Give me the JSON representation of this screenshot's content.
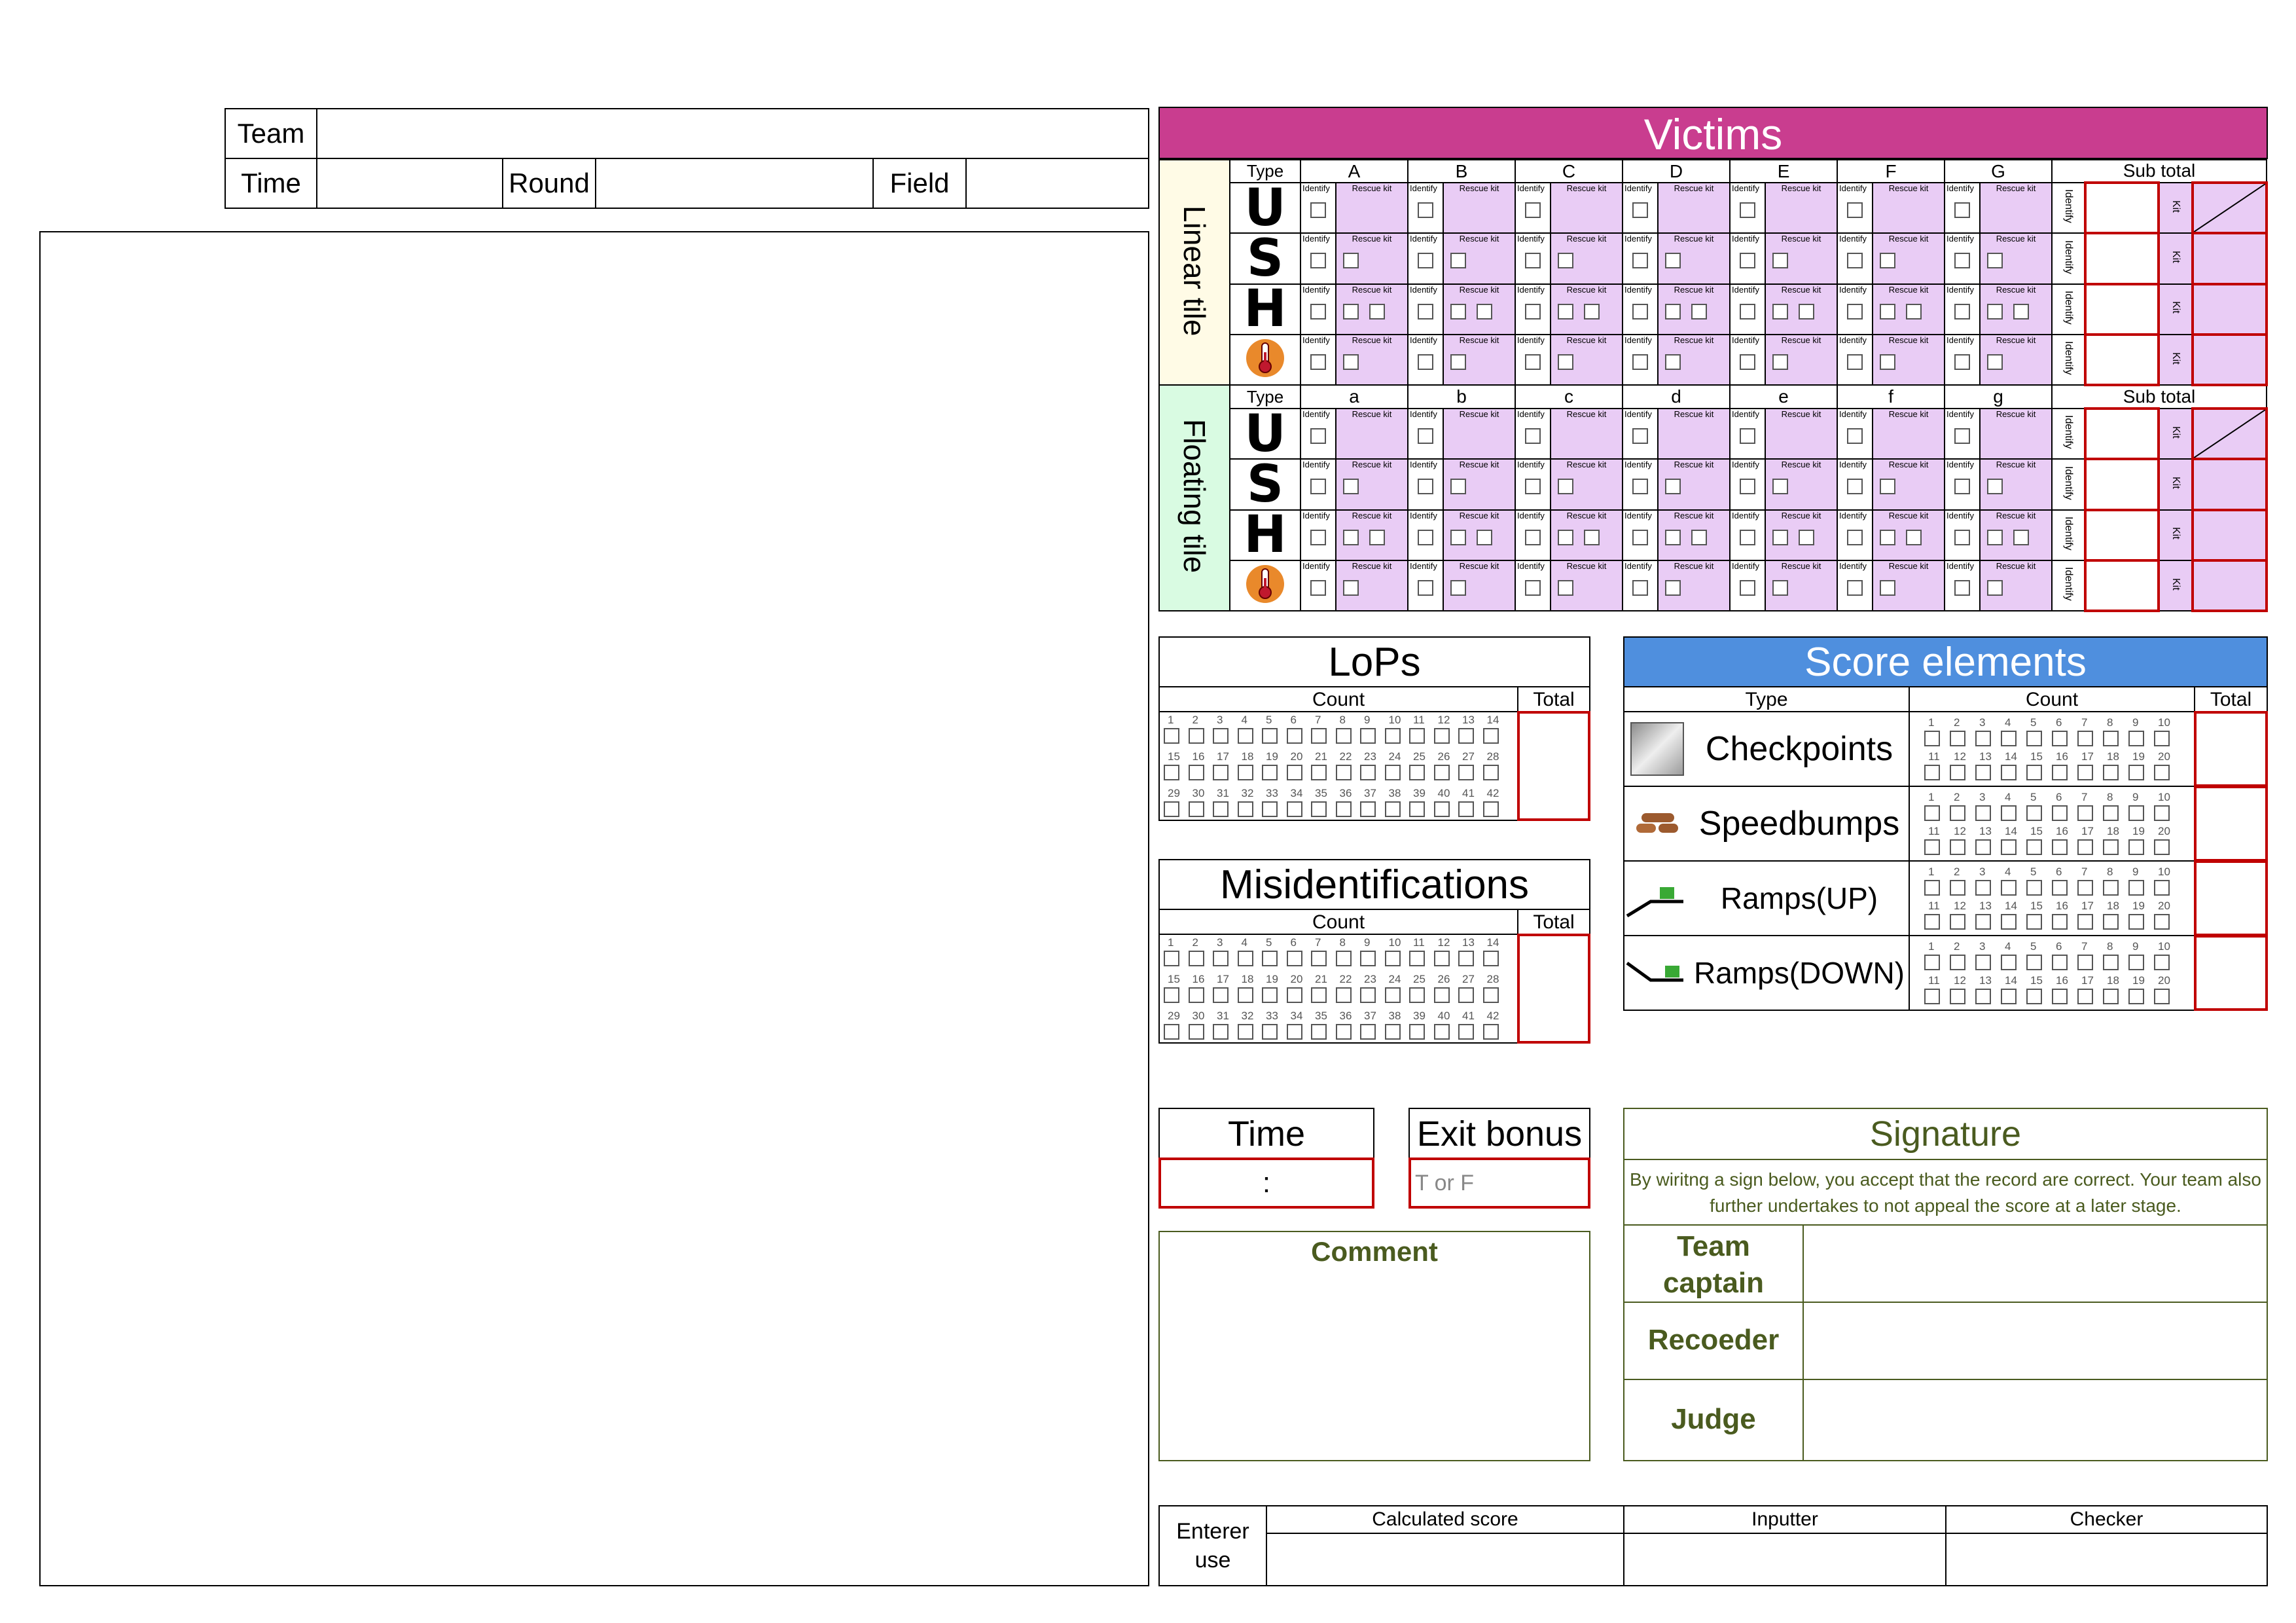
{
  "header": {
    "team_label": "Team",
    "time_label": "Time",
    "round_label": "Round",
    "field_label": "Field"
  },
  "victims": {
    "title": "Victims",
    "type_label": "Type",
    "subtotal_label": "Sub total",
    "linear_label": "Linear tile",
    "floating_label": "Floating tile",
    "linear_columns": [
      "A",
      "B",
      "C",
      "D",
      "E",
      "F",
      "G"
    ],
    "floating_columns": [
      "a",
      "b",
      "c",
      "d",
      "e",
      "f",
      "g"
    ],
    "row_types": [
      "U",
      "S",
      "H",
      "heat"
    ],
    "identify_label": "Identify",
    "rescue_kit_label": "Rescue kit",
    "kit_label": "Kit",
    "rescue_kit_boxes": [
      0,
      1,
      2,
      1
    ],
    "colors": {
      "header": "#c93d8f",
      "linear": "#fffbe6",
      "floating": "#d9fbe2",
      "pink": "#e9ccf5"
    }
  },
  "lops": {
    "title": "LoPs",
    "count_label": "Count",
    "total_label": "Total",
    "numbers": [
      "1",
      "2",
      "3",
      "4",
      "5",
      "6",
      "7",
      "8",
      "9",
      "10",
      "11",
      "12",
      "13",
      "14",
      "15",
      "16",
      "17",
      "18",
      "19",
      "20",
      "21",
      "22",
      "23",
      "24",
      "25",
      "26",
      "27",
      "28",
      "29",
      "30",
      "31",
      "32",
      "33",
      "34",
      "35",
      "36",
      "37",
      "38",
      "39",
      "40",
      "41",
      "42"
    ]
  },
  "misid": {
    "title": "Misidentifications",
    "count_label": "Count",
    "total_label": "Total"
  },
  "score_elements": {
    "title": "Score elements",
    "type_label": "Type",
    "count_label": "Count",
    "total_label": "Total",
    "color": "#4f8fde",
    "numbers": [
      "1",
      "2",
      "3",
      "4",
      "5",
      "6",
      "7",
      "8",
      "9",
      "10",
      "11",
      "12",
      "13",
      "14",
      "15",
      "16",
      "17",
      "18",
      "19",
      "20"
    ],
    "rows": [
      {
        "label": "Checkpoints",
        "icon": "checkpoint-icon"
      },
      {
        "label": "Speedbumps",
        "icon": "speedbump-icon"
      },
      {
        "label": "Ramps(UP)",
        "icon": "ramp-up-icon"
      },
      {
        "label": "Ramps(DOWN)",
        "icon": "ramp-down-icon"
      }
    ]
  },
  "time_box": {
    "title": "Time",
    "value": ":"
  },
  "exit_bonus": {
    "title": "Exit bonus",
    "placeholder": "T or F"
  },
  "comment": {
    "title": "Comment"
  },
  "signature": {
    "title": "Signature",
    "text": "By wiritng a sign below, you accept that the record are correct. Your team also further undertakes to not appeal the score at a later stage.",
    "captain_label": "Team captain",
    "recorder_label": "Recoeder",
    "judge_label": "Judge"
  },
  "enterer": {
    "label": "Enterer use",
    "calculated_label": "Calculated score",
    "inputter_label": "Inputter",
    "checker_label": "Checker"
  }
}
